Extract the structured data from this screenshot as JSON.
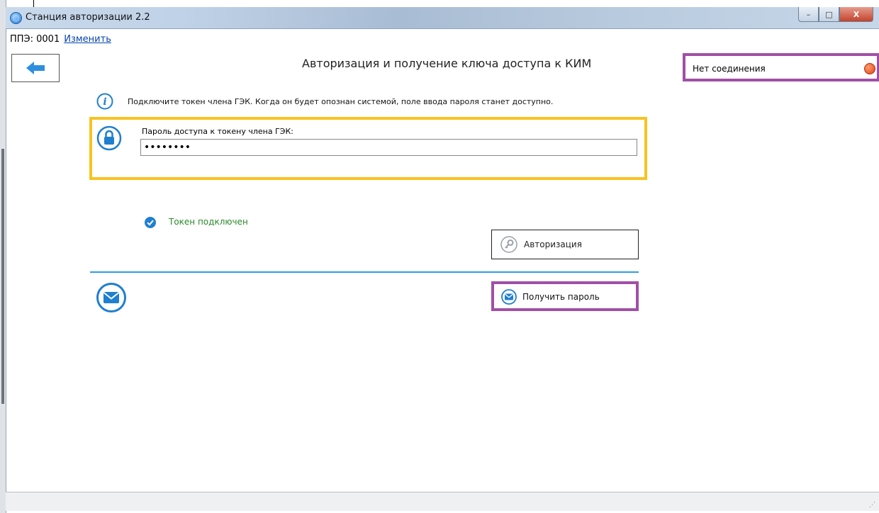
{
  "window": {
    "title": "Станция авторизации 2.2",
    "minimize_glyph": "–",
    "maximize_glyph": "□",
    "close_glyph": "X"
  },
  "toprow": {
    "ppe_label": "ППЭ: 0001",
    "change_link": "Изменить"
  },
  "page": {
    "title": "Авторизация и получение ключа доступа к КИМ"
  },
  "connection": {
    "status_text": "Нет соединения",
    "status_color": "#e0441b"
  },
  "info": {
    "text": "Подключите токен члена ГЭК. Когда он будет опознан системой, поле ввода пароля станет доступно."
  },
  "password": {
    "label": "Пароль доступа к токену члена ГЭК:",
    "value": "••••••••"
  },
  "token": {
    "status_text": "Токен подключен",
    "status_color": "#2a8a2a"
  },
  "buttons": {
    "auth_label": "Авторизация",
    "get_password_label": "Получить пароль"
  },
  "colors": {
    "accent_blue": "#2d9ee6",
    "highlight_yellow": "#f6c421",
    "highlight_purple": "#a14fa6"
  }
}
